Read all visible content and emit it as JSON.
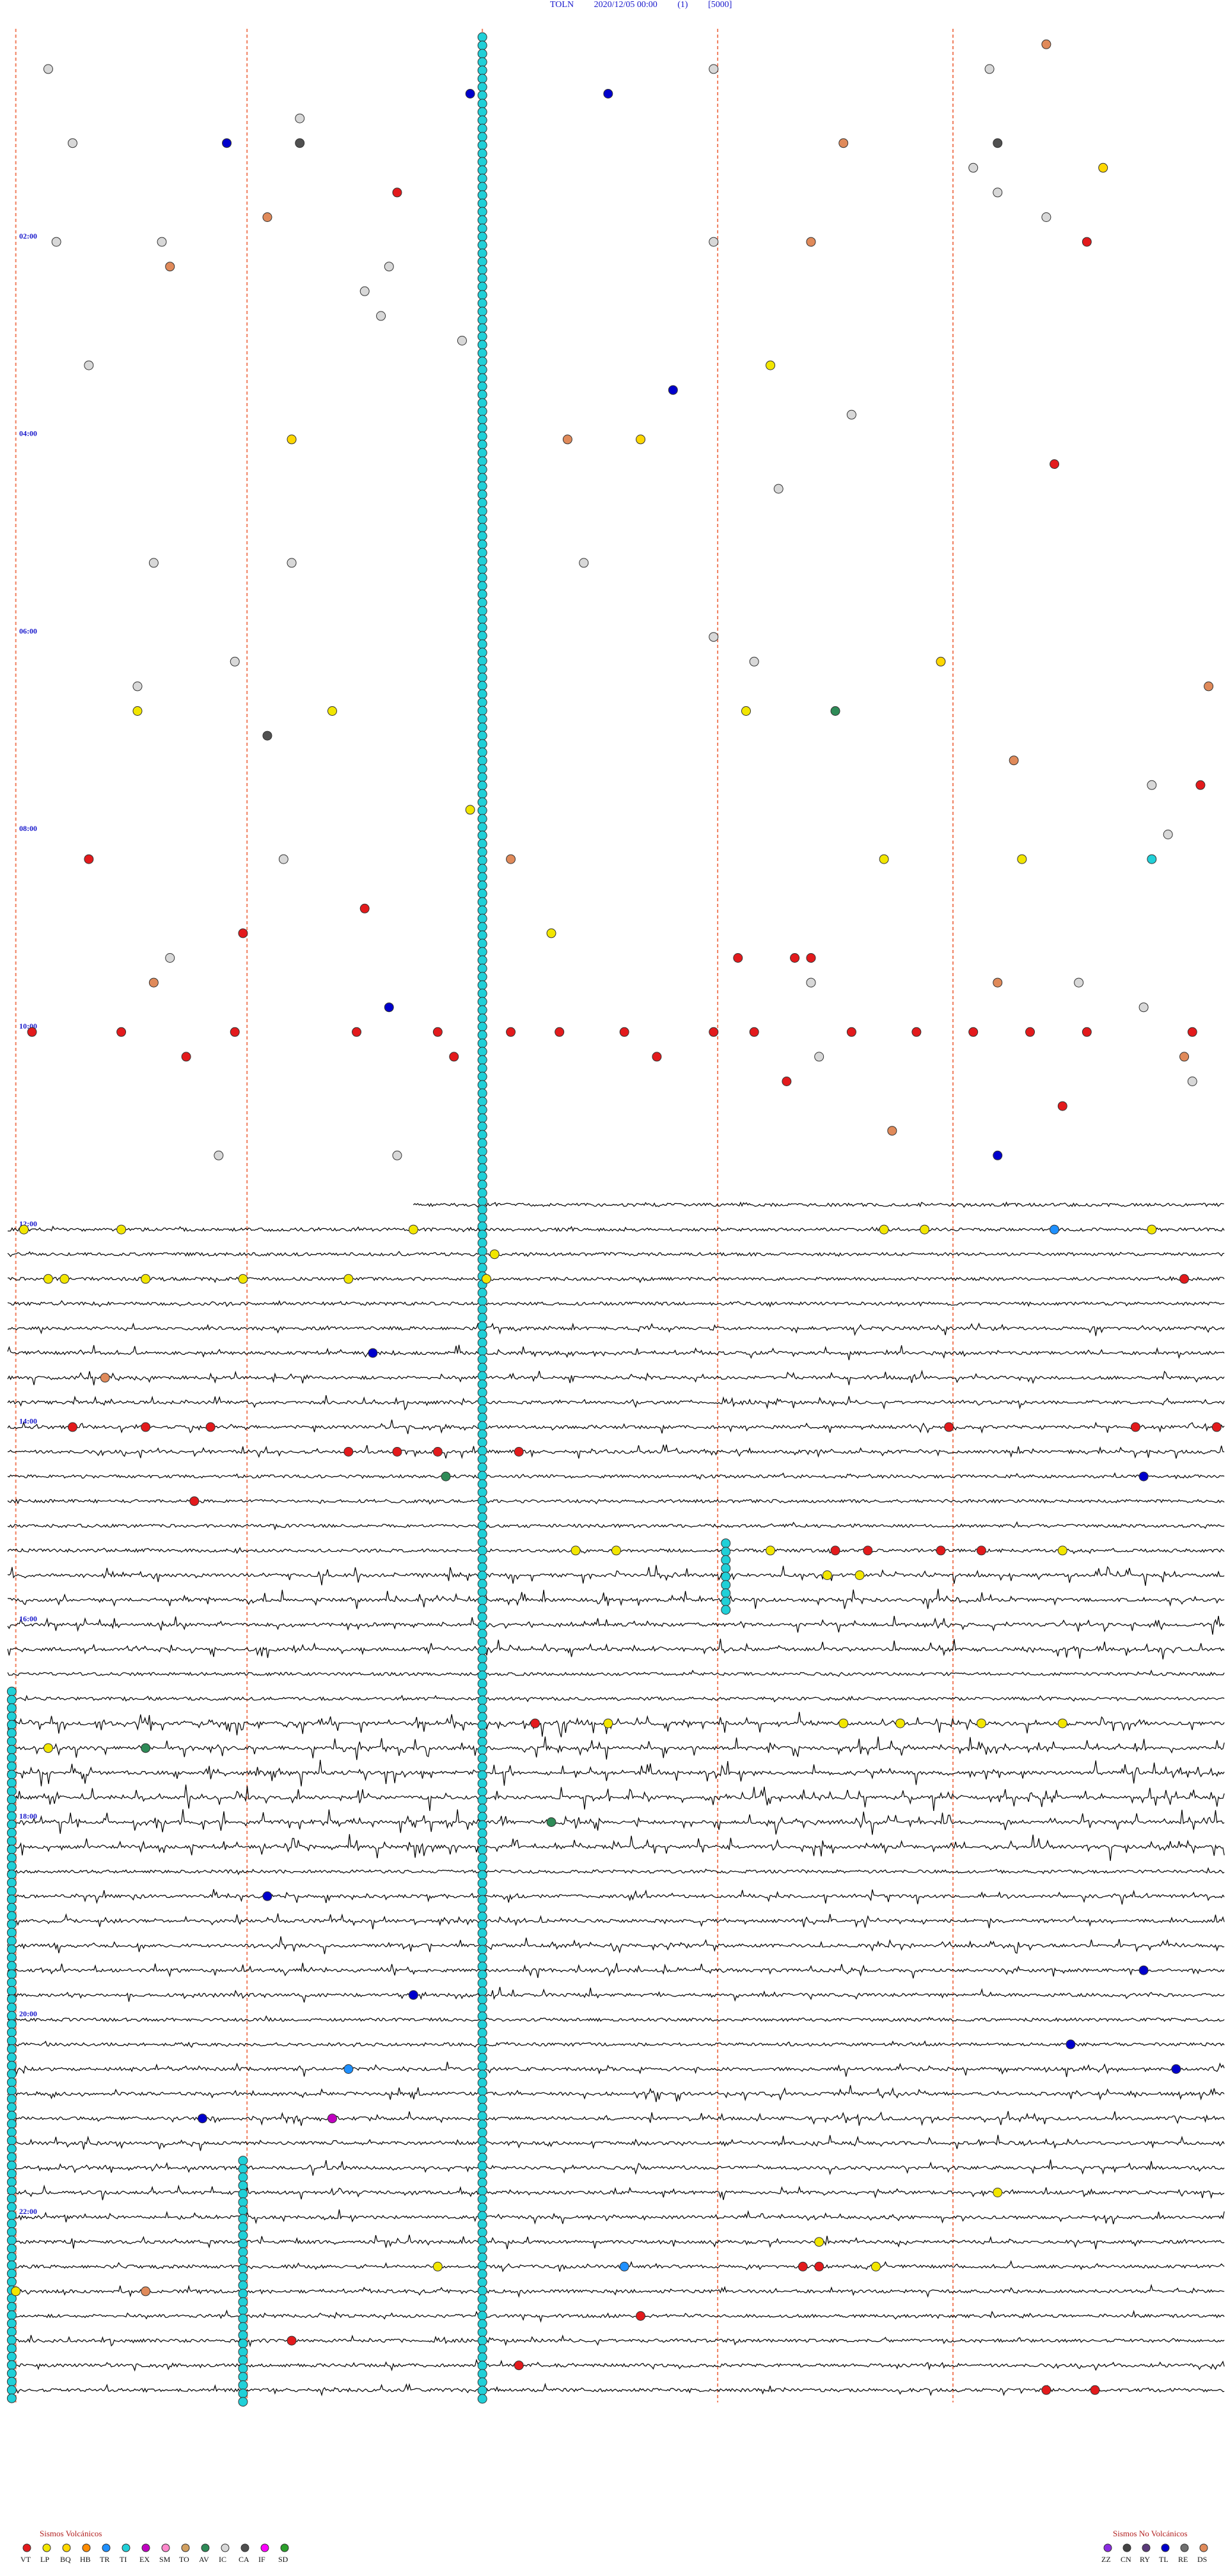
{
  "header": {
    "station": "TOLN",
    "date_time": "2020/12/05 00:00",
    "channel": "(1)",
    "scale": "[5000]"
  },
  "chart_data": {
    "type": "scatter",
    "title": "TOLN 2020/12/05 00:00 (1) [5000]",
    "description_of_axes": "helicorder drum: rows are 15-minute traces from 00:00 to 24:00; x is minute within the row",
    "x_range_minutes": [
      0,
      15
    ],
    "rows": 96,
    "time_labels": [
      "02:00",
      "04:00",
      "06:00",
      "08:00",
      "10:00",
      "12:00",
      "14:00",
      "16:00",
      "18:00",
      "20:00",
      "22:00"
    ],
    "time_label_rows": [
      8,
      16,
      24,
      32,
      40,
      48,
      56,
      64,
      72,
      80,
      88
    ],
    "dashed_minute_marks": [
      0.1,
      2.95,
      5.85,
      8.75,
      11.65
    ],
    "trace_start_row": 47,
    "trace_start_minute": 5.0,
    "activity_segments": [
      {
        "row_from": 52,
        "row_to": 58,
        "level": 0.5
      },
      {
        "row_from": 62,
        "row_to": 66,
        "level": 0.7
      },
      {
        "row_from": 68,
        "row_to": 74,
        "level": 0.9
      },
      {
        "row_from": 75,
        "row_to": 80,
        "level": 0.55
      },
      {
        "row_from": 82,
        "row_to": 90,
        "level": 0.5
      },
      {
        "row_from": 90,
        "row_to": 96,
        "level": 0.35
      }
    ],
    "events": [
      {
        "row": 0,
        "min": 12.8,
        "type": "DS"
      },
      {
        "row": 1,
        "min": 0.5,
        "type": "IC"
      },
      {
        "row": 1,
        "min": 8.7,
        "type": "IC"
      },
      {
        "row": 1,
        "min": 12.1,
        "type": "IC"
      },
      {
        "row": 2,
        "min": 5.7,
        "type": "TL"
      },
      {
        "row": 2,
        "min": 7.4,
        "type": "TL"
      },
      {
        "row": 3,
        "min": 3.6,
        "type": "IC"
      },
      {
        "row": 4,
        "min": 0.8,
        "type": "IC"
      },
      {
        "row": 4,
        "min": 2.7,
        "type": "TL"
      },
      {
        "row": 4,
        "min": 3.6,
        "type": "CA"
      },
      {
        "row": 4,
        "min": 10.3,
        "type": "DS"
      },
      {
        "row": 4,
        "min": 12.2,
        "type": "CA"
      },
      {
        "row": 5,
        "min": 11.9,
        "type": "IC"
      },
      {
        "row": 5,
        "min": 13.5,
        "type": "BQ"
      },
      {
        "row": 6,
        "min": 4.8,
        "type": "VT"
      },
      {
        "row": 6,
        "min": 12.2,
        "type": "IC"
      },
      {
        "row": 7,
        "min": 3.2,
        "type": "DS"
      },
      {
        "row": 7,
        "min": 12.8,
        "type": "IC"
      },
      {
        "row": 8,
        "min": 0.6,
        "type": "IC"
      },
      {
        "row": 8,
        "min": 1.9,
        "type": "IC"
      },
      {
        "row": 8,
        "min": 9.9,
        "type": "DS"
      },
      {
        "row": 8,
        "min": 8.7,
        "type": "IC"
      },
      {
        "row": 8,
        "min": 13.3,
        "type": "VT"
      },
      {
        "row": 9,
        "min": 2.0,
        "type": "DS"
      },
      {
        "row": 9,
        "min": 4.7,
        "type": "IC"
      },
      {
        "row": 10,
        "min": 4.4,
        "type": "IC"
      },
      {
        "row": 11,
        "min": 4.6,
        "type": "IC"
      },
      {
        "row": 12,
        "min": 5.6,
        "type": "IC"
      },
      {
        "row": 13,
        "min": 1.0,
        "type": "IC"
      },
      {
        "row": 13,
        "min": 9.4,
        "type": "LP"
      },
      {
        "row": 14,
        "min": 8.2,
        "type": "TL"
      },
      {
        "row": 15,
        "min": 10.4,
        "type": "IC"
      },
      {
        "row": 16,
        "min": 3.5,
        "type": "BQ"
      },
      {
        "row": 16,
        "min": 6.9,
        "type": "DS"
      },
      {
        "row": 16,
        "min": 7.8,
        "type": "BQ"
      },
      {
        "row": 17,
        "min": 12.9,
        "type": "VT"
      },
      {
        "row": 18,
        "min": 9.5,
        "type": "IC"
      },
      {
        "row": 21,
        "min": 1.8,
        "type": "IC"
      },
      {
        "row": 21,
        "min": 3.5,
        "type": "IC"
      },
      {
        "row": 21,
        "min": 7.1,
        "type": "IC"
      },
      {
        "row": 24,
        "min": 8.7,
        "type": "IC"
      },
      {
        "row": 25,
        "min": 2.8,
        "type": "IC"
      },
      {
        "row": 25,
        "min": 9.2,
        "type": "IC"
      },
      {
        "row": 25,
        "min": 11.5,
        "type": "BQ"
      },
      {
        "row": 26,
        "min": 1.6,
        "type": "IC"
      },
      {
        "row": 26,
        "min": 14.8,
        "type": "DS"
      },
      {
        "row": 27,
        "min": 1.6,
        "type": "LP"
      },
      {
        "row": 27,
        "min": 4.0,
        "type": "LP"
      },
      {
        "row": 27,
        "min": 9.1,
        "type": "LP"
      },
      {
        "row": 27,
        "min": 10.2,
        "type": "AV"
      },
      {
        "row": 28,
        "min": 3.2,
        "type": "CA"
      },
      {
        "row": 29,
        "min": 12.4,
        "type": "DS"
      },
      {
        "row": 30,
        "min": 14.1,
        "type": "IC"
      },
      {
        "row": 30,
        "min": 14.7,
        "type": "VT"
      },
      {
        "row": 31,
        "min": 5.7,
        "type": "LP"
      },
      {
        "row": 32,
        "min": 14.3,
        "type": "IC"
      },
      {
        "row": 33,
        "min": 1.0,
        "type": "VT"
      },
      {
        "row": 33,
        "min": 3.4,
        "type": "IC"
      },
      {
        "row": 33,
        "min": 6.2,
        "type": "DS"
      },
      {
        "row": 33,
        "min": 10.8,
        "type": "LP"
      },
      {
        "row": 33,
        "min": 12.5,
        "type": "LP"
      },
      {
        "row": 33,
        "min": 14.1,
        "type": "TI"
      },
      {
        "row": 35,
        "min": 4.4,
        "type": "VT"
      },
      {
        "row": 36,
        "min": 6.7,
        "type": "LP"
      },
      {
        "row": 36,
        "min": 2.9,
        "type": "VT"
      },
      {
        "row": 37,
        "min": 2.0,
        "type": "IC"
      },
      {
        "row": 37,
        "min": 9.0,
        "type": "VT"
      },
      {
        "row": 37,
        "min": 9.7,
        "type": "VT"
      },
      {
        "row": 37,
        "min": 9.9,
        "type": "VT"
      },
      {
        "row": 38,
        "min": 1.8,
        "type": "DS"
      },
      {
        "row": 38,
        "min": 9.9,
        "type": "IC"
      },
      {
        "row": 38,
        "min": 12.2,
        "type": "DS"
      },
      {
        "row": 38,
        "min": 13.2,
        "type": "IC"
      },
      {
        "row": 39,
        "min": 4.7,
        "type": "TL"
      },
      {
        "row": 39,
        "min": 14.0,
        "type": "IC"
      },
      {
        "row": 40,
        "min": 0.3,
        "type": "VT"
      },
      {
        "row": 40,
        "min": 1.4,
        "type": "VT"
      },
      {
        "row": 40,
        "min": 2.8,
        "type": "VT"
      },
      {
        "row": 40,
        "min": 4.3,
        "type": "VT"
      },
      {
        "row": 40,
        "min": 5.3,
        "type": "VT"
      },
      {
        "row": 40,
        "min": 6.2,
        "type": "VT"
      },
      {
        "row": 40,
        "min": 6.8,
        "type": "VT"
      },
      {
        "row": 40,
        "min": 7.6,
        "type": "VT"
      },
      {
        "row": 40,
        "min": 8.7,
        "type": "VT"
      },
      {
        "row": 40,
        "min": 9.2,
        "type": "VT"
      },
      {
        "row": 40,
        "min": 10.4,
        "type": "VT"
      },
      {
        "row": 40,
        "min": 11.2,
        "type": "VT"
      },
      {
        "row": 40,
        "min": 11.9,
        "type": "VT"
      },
      {
        "row": 40,
        "min": 12.6,
        "type": "VT"
      },
      {
        "row": 40,
        "min": 13.3,
        "type": "VT"
      },
      {
        "row": 40,
        "min": 14.6,
        "type": "VT"
      },
      {
        "row": 41,
        "min": 2.2,
        "type": "VT"
      },
      {
        "row": 41,
        "min": 5.5,
        "type": "VT"
      },
      {
        "row": 41,
        "min": 8.0,
        "type": "VT"
      },
      {
        "row": 41,
        "min": 10.0,
        "type": "IC"
      },
      {
        "row": 41,
        "min": 14.5,
        "type": "DS"
      },
      {
        "row": 42,
        "min": 9.6,
        "type": "VT"
      },
      {
        "row": 42,
        "min": 14.6,
        "type": "IC"
      },
      {
        "row": 43,
        "min": 13.0,
        "type": "VT"
      },
      {
        "row": 44,
        "min": 10.9,
        "type": "DS"
      },
      {
        "row": 45,
        "min": 2.6,
        "type": "IC"
      },
      {
        "row": 45,
        "min": 4.8,
        "type": "IC"
      },
      {
        "row": 45,
        "min": 12.2,
        "type": "TL"
      },
      {
        "row": 48,
        "min": 0.2,
        "type": "LP"
      },
      {
        "row": 48,
        "min": 1.4,
        "type": "LP"
      },
      {
        "row": 48,
        "min": 5.0,
        "type": "LP"
      },
      {
        "row": 48,
        "min": 10.8,
        "type": "LP"
      },
      {
        "row": 48,
        "min": 11.3,
        "type": "LP"
      },
      {
        "row": 48,
        "min": 12.9,
        "type": "TR"
      },
      {
        "row": 48,
        "min": 14.1,
        "type": "LP"
      },
      {
        "row": 49,
        "min": 6.0,
        "type": "LP"
      },
      {
        "row": 50,
        "min": 0.5,
        "type": "LP"
      },
      {
        "row": 50,
        "min": 0.7,
        "type": "LP"
      },
      {
        "row": 50,
        "min": 1.7,
        "type": "LP"
      },
      {
        "row": 50,
        "min": 2.9,
        "type": "LP"
      },
      {
        "row": 50,
        "min": 4.2,
        "type": "LP"
      },
      {
        "row": 50,
        "min": 5.9,
        "type": "LP"
      },
      {
        "row": 50,
        "min": 14.5,
        "type": "VT"
      },
      {
        "row": 53,
        "min": 4.5,
        "type": "TL"
      },
      {
        "row": 54,
        "min": 1.2,
        "type": "DS"
      },
      {
        "row": 56,
        "min": 0.8,
        "type": "VT"
      },
      {
        "row": 56,
        "min": 1.7,
        "type": "VT"
      },
      {
        "row": 56,
        "min": 2.5,
        "type": "VT"
      },
      {
        "row": 56,
        "min": 11.6,
        "type": "VT"
      },
      {
        "row": 56,
        "min": 13.9,
        "type": "VT"
      },
      {
        "row": 56,
        "min": 14.9,
        "type": "VT"
      },
      {
        "row": 57,
        "min": 4.2,
        "type": "VT"
      },
      {
        "row": 57,
        "min": 4.8,
        "type": "VT"
      },
      {
        "row": 57,
        "min": 5.3,
        "type": "VT"
      },
      {
        "row": 57,
        "min": 6.3,
        "type": "VT"
      },
      {
        "row": 58,
        "min": 5.4,
        "type": "AV"
      },
      {
        "row": 58,
        "min": 14.0,
        "type": "TL"
      },
      {
        "row": 59,
        "min": 2.3,
        "type": "VT"
      },
      {
        "row": 61,
        "min": 7.0,
        "type": "LP"
      },
      {
        "row": 61,
        "min": 7.5,
        "type": "LP"
      },
      {
        "row": 61,
        "min": 9.4,
        "type": "LP"
      },
      {
        "row": 61,
        "min": 10.2,
        "type": "VT"
      },
      {
        "row": 61,
        "min": 10.6,
        "type": "VT"
      },
      {
        "row": 61,
        "min": 11.5,
        "type": "VT"
      },
      {
        "row": 61,
        "min": 12.0,
        "type": "VT"
      },
      {
        "row": 61,
        "min": 13.0,
        "type": "LP"
      },
      {
        "row": 62,
        "min": 10.1,
        "type": "LP"
      },
      {
        "row": 62,
        "min": 10.5,
        "type": "LP"
      },
      {
        "row": 68,
        "min": 6.5,
        "type": "VT"
      },
      {
        "row": 68,
        "min": 7.4,
        "type": "LP"
      },
      {
        "row": 68,
        "min": 10.3,
        "type": "LP"
      },
      {
        "row": 68,
        "min": 11.0,
        "type": "LP"
      },
      {
        "row": 68,
        "min": 12.0,
        "type": "LP"
      },
      {
        "row": 68,
        "min": 13.0,
        "type": "LP"
      },
      {
        "row": 69,
        "min": 0.5,
        "type": "LP"
      },
      {
        "row": 69,
        "min": 1.7,
        "type": "AV"
      },
      {
        "row": 72,
        "min": 6.7,
        "type": "AV"
      },
      {
        "row": 75,
        "min": 3.2,
        "type": "TL"
      },
      {
        "row": 78,
        "min": 14.0,
        "type": "TL"
      },
      {
        "row": 79,
        "min": 5.0,
        "type": "TL"
      },
      {
        "row": 81,
        "min": 13.1,
        "type": "TL"
      },
      {
        "row": 82,
        "min": 4.2,
        "type": "TR"
      },
      {
        "row": 82,
        "min": 14.4,
        "type": "TL"
      },
      {
        "row": 84,
        "min": 2.4,
        "type": "TL"
      },
      {
        "row": 84,
        "min": 4.0,
        "type": "EX"
      },
      {
        "row": 87,
        "min": 12.2,
        "type": "LP"
      },
      {
        "row": 89,
        "min": 10.0,
        "type": "LP"
      },
      {
        "row": 90,
        "min": 5.3,
        "type": "LP"
      },
      {
        "row": 90,
        "min": 7.6,
        "type": "TR"
      },
      {
        "row": 90,
        "min": 9.8,
        "type": "VT"
      },
      {
        "row": 90,
        "min": 10.0,
        "type": "VT"
      },
      {
        "row": 90,
        "min": 10.7,
        "type": "LP"
      },
      {
        "row": 91,
        "min": 0.1,
        "type": "LP"
      },
      {
        "row": 91,
        "min": 1.7,
        "type": "DS"
      },
      {
        "row": 92,
        "min": 7.8,
        "type": "VT"
      },
      {
        "row": 93,
        "min": 3.5,
        "type": "VT"
      },
      {
        "row": 94,
        "min": 6.3,
        "type": "VT"
      },
      {
        "row": 95,
        "min": 12.8,
        "type": "VT"
      },
      {
        "row": 95,
        "min": 13.4,
        "type": "VT"
      }
    ],
    "cyan_columns": [
      {
        "minute": 5.85,
        "row_from": 0,
        "row_to": 96
      },
      {
        "minute": 2.9,
        "row_from": 86,
        "row_to": 96
      },
      {
        "minute": 8.85,
        "row_from": 61,
        "row_to": 64
      },
      {
        "minute": 0.05,
        "row_from": 67,
        "row_to": 96
      }
    ],
    "legend_volcanic": {
      "title": "Sismos Volcánicos",
      "items": [
        {
          "code": "VT",
          "color": "#e31a1c"
        },
        {
          "code": "LP",
          "color": "#f2e600"
        },
        {
          "code": "BQ",
          "color": "#ffd700"
        },
        {
          "code": "HB",
          "color": "#ff8c00"
        },
        {
          "code": "TR",
          "color": "#1e90ff"
        },
        {
          "code": "TI",
          "color": "#20d0d8"
        },
        {
          "code": "EX",
          "color": "#c000c0"
        },
        {
          "code": "SM",
          "color": "#ff88cc"
        },
        {
          "code": "TO",
          "color": "#d2a060"
        },
        {
          "code": "AV",
          "color": "#2e8b57"
        },
        {
          "code": "IC",
          "color": "#d8d8d8"
        },
        {
          "code": "CA",
          "color": "#505050"
        },
        {
          "code": "IF",
          "color": "#ff00ff"
        },
        {
          "code": "SD",
          "color": "#2ca02c"
        }
      ]
    },
    "legend_non_volcanic": {
      "title": "Sismos No Volcánicos",
      "items": [
        {
          "code": "ZZ",
          "color": "#8a2be2"
        },
        {
          "code": "CN",
          "color": "#444444"
        },
        {
          "code": "RY",
          "color": "#5a3a7a"
        },
        {
          "code": "TL",
          "color": "#0000cc"
        },
        {
          "code": "RE",
          "color": "#707070"
        },
        {
          "code": "DS",
          "color": "#e08a5a"
        }
      ]
    }
  },
  "colors": {
    "label_blue": "#1a1acc",
    "dash_orange": "#f08060",
    "trace_black": "#000000",
    "cyan": "#20d0d8"
  }
}
